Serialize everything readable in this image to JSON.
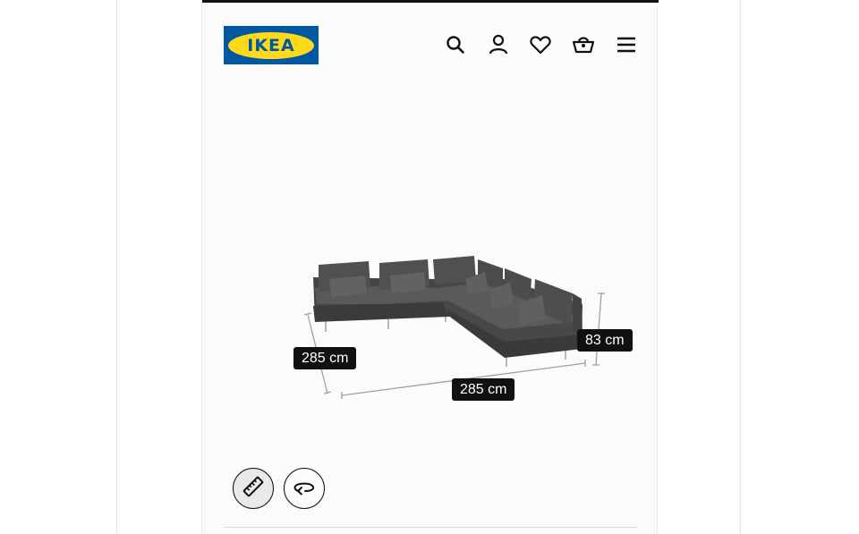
{
  "brand": {
    "logo_text": "IKEA",
    "primary_blue": "#0058a3",
    "primary_yellow": "#ffda1a"
  },
  "header": {
    "icons": [
      "search-icon",
      "profile-icon",
      "heart-icon",
      "basket-icon",
      "menu-icon"
    ]
  },
  "viewer": {
    "dimensions": {
      "depth_label": "285 cm",
      "width_label": "285 cm",
      "height_label": "83 cm"
    },
    "tools": [
      "measure-tool",
      "rotate-tool"
    ],
    "sofa_color": "#4a4a4b"
  }
}
